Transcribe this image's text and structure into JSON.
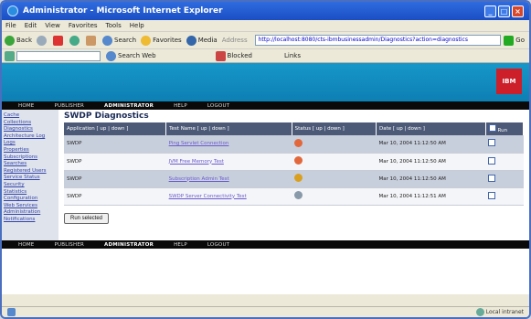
{
  "window": {
    "title": "Administrator - Microsoft Internet Explorer"
  },
  "menu": [
    "File",
    "Edit",
    "View",
    "Favorites",
    "Tools",
    "Help"
  ],
  "toolbar": {
    "back": "Back",
    "search": "Search",
    "favorites": "Favorites",
    "media": "Media",
    "address_label": "Address",
    "address": "http://localhost:8080/cts-ibmbusinessadmin/Diagnostics?action=diagnostics",
    "go": "Go"
  },
  "linkbar": {
    "search_web": "Search Web",
    "blocked": "Blocked",
    "links": "Links"
  },
  "banner": {
    "logo_text": "IBM"
  },
  "nav": [
    "HOME",
    "PUBLISHER",
    "ADMINISTRATOR",
    "HELP",
    "LOGOUT"
  ],
  "sidebar": [
    "Cache",
    "Collections",
    "Diagnostics",
    "Architecture Log",
    "Logs",
    "Properties",
    "Subscriptions",
    "Searches",
    "Registered Users",
    "Service Status",
    "Security",
    "Statistics",
    "Configuration",
    "Web Services",
    "Administration",
    "Notifications"
  ],
  "page": {
    "title": "SWDP Diagnostics"
  },
  "table": {
    "headers": [
      "Application [ up | down ]",
      "Test Name [ up | down ]",
      "Status [ up | down ]",
      "Date [ up | down ]",
      "Run"
    ],
    "rows": [
      {
        "app": "SWDP",
        "test": "Ping Servlet Connection",
        "date": "Mar 10, 2004 11:12:50 AM",
        "status_color": "#e2683c"
      },
      {
        "app": "SWDP",
        "test": "JVM Free Memory Test",
        "date": "Mar 10, 2004 11:12:50 AM",
        "status_color": "#e2683c"
      },
      {
        "app": "SWDP",
        "test": "Subscription Admin Test",
        "date": "Mar 10, 2004 11:12:50 AM",
        "status_color": "#d9a020"
      },
      {
        "app": "SWDP",
        "test": "SWDP Server Connectivity Test",
        "date": "Mar 10, 2004 11:12:51 AM",
        "status_color": "#8899aa"
      }
    ]
  },
  "actions": {
    "run_selected": "Run selected"
  },
  "statusbar": {
    "zone": "Local intranet"
  }
}
